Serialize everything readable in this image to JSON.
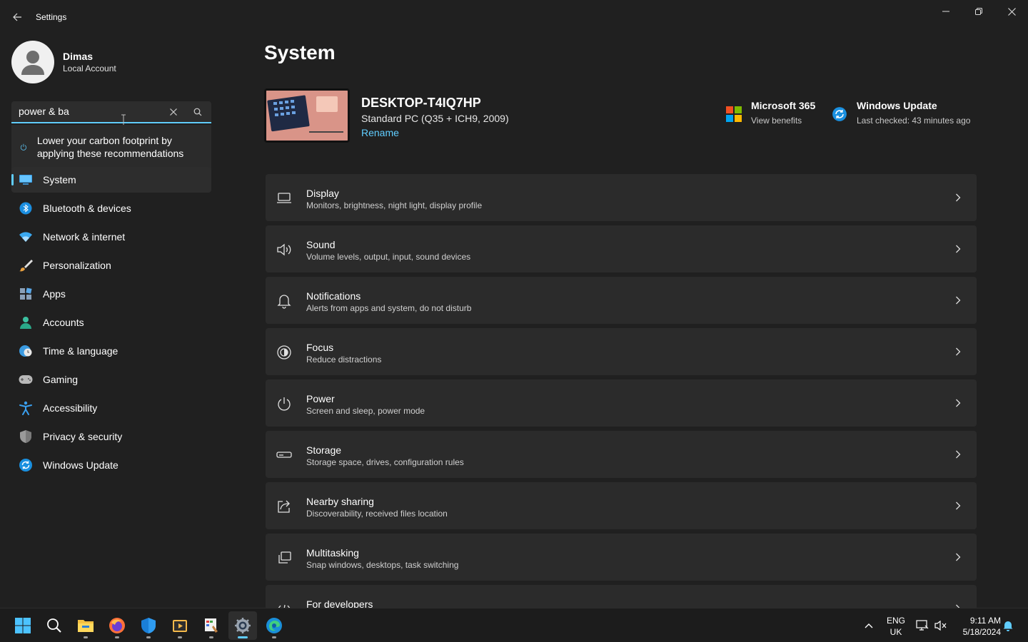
{
  "window": {
    "title": "Settings"
  },
  "profile": {
    "name": "Dimas",
    "account_type": "Local Account"
  },
  "search": {
    "value": "power & ba",
    "suggestion": "Lower your carbon footprint by applying these recommendations"
  },
  "sidebar": {
    "items": [
      {
        "label": "System",
        "icon": "system-icon",
        "selected": true
      },
      {
        "label": "Bluetooth & devices",
        "icon": "bluetooth-icon"
      },
      {
        "label": "Network & internet",
        "icon": "wifi-icon"
      },
      {
        "label": "Personalization",
        "icon": "brush-icon"
      },
      {
        "label": "Apps",
        "icon": "apps-icon"
      },
      {
        "label": "Accounts",
        "icon": "person-icon"
      },
      {
        "label": "Time & language",
        "icon": "globe-clock-icon"
      },
      {
        "label": "Gaming",
        "icon": "gamepad-icon"
      },
      {
        "label": "Accessibility",
        "icon": "accessibility-icon"
      },
      {
        "label": "Privacy & security",
        "icon": "shield-icon"
      },
      {
        "label": "Windows Update",
        "icon": "update-icon"
      }
    ]
  },
  "main": {
    "title": "System",
    "device": {
      "name": "DESKTOP-T4IQ7HP",
      "spec": "Standard PC (Q35 + ICH9, 2009)",
      "rename_label": "Rename"
    },
    "quick_tiles": [
      {
        "title": "Microsoft 365",
        "subtitle": "View benefits",
        "icon": "microsoft-logo-icon"
      },
      {
        "title": "Windows Update",
        "subtitle": "Last checked: 43 minutes ago",
        "icon": "update-icon"
      }
    ],
    "settings": [
      {
        "title": "Display",
        "desc": "Monitors, brightness, night light, display profile",
        "icon": "display-icon"
      },
      {
        "title": "Sound",
        "desc": "Volume levels, output, input, sound devices",
        "icon": "speaker-icon"
      },
      {
        "title": "Notifications",
        "desc": "Alerts from apps and system, do not disturb",
        "icon": "bell-icon"
      },
      {
        "title": "Focus",
        "desc": "Reduce distractions",
        "icon": "focus-icon"
      },
      {
        "title": "Power",
        "desc": "Screen and sleep, power mode",
        "icon": "power-icon"
      },
      {
        "title": "Storage",
        "desc": "Storage space, drives, configuration rules",
        "icon": "storage-icon"
      },
      {
        "title": "Nearby sharing",
        "desc": "Discoverability, received files location",
        "icon": "share-icon"
      },
      {
        "title": "Multitasking",
        "desc": "Snap windows, desktops, task switching",
        "icon": "multitask-icon"
      },
      {
        "title": "For developers",
        "desc": "",
        "icon": "developer-icon"
      }
    ]
  },
  "taskbar": {
    "apps": [
      "start-icon",
      "search-icon",
      "file-explorer-icon",
      "firefox-icon",
      "defender-icon",
      "media-player-icon",
      "paint-icon",
      "settings-icon",
      "edge-icon"
    ],
    "language": {
      "line1": "ENG",
      "line2": "UK"
    },
    "clock": {
      "time": "9:11 AM",
      "date": "5/18/2024"
    }
  },
  "colors": {
    "accent": "#60cdff",
    "background": "#202020",
    "card": "#2b2b2b"
  }
}
